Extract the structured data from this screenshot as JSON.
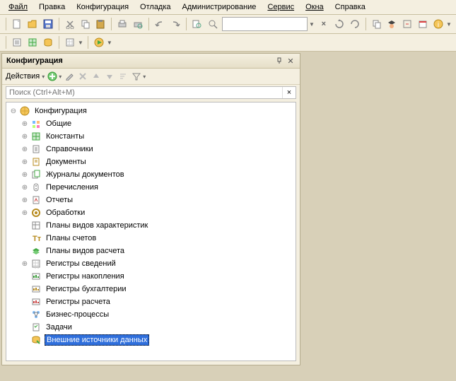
{
  "menu": {
    "file": "Файл",
    "edit": "Правка",
    "config": "Конфигурация",
    "debug": "Отладка",
    "admin": "Администрирование",
    "service": "Сервис",
    "windows": "Окна",
    "help": "Справка"
  },
  "search": {
    "placeholder": "",
    "clear": "×"
  },
  "panel": {
    "title": "Конфигурация",
    "actions_label": "Действия",
    "search_placeholder": "Поиск (Ctrl+Alt+M)",
    "search_clear": "×"
  },
  "tree": {
    "root": "Конфигурация",
    "items": [
      {
        "label": "Общие",
        "exp": "⊕"
      },
      {
        "label": "Константы",
        "exp": "⊕"
      },
      {
        "label": "Справочники",
        "exp": "⊕"
      },
      {
        "label": "Документы",
        "exp": "⊕"
      },
      {
        "label": "Журналы документов",
        "exp": "⊕"
      },
      {
        "label": "Перечисления",
        "exp": "⊕"
      },
      {
        "label": "Отчеты",
        "exp": "⊕"
      },
      {
        "label": "Обработки",
        "exp": "⊕"
      },
      {
        "label": "Планы видов характеристик",
        "exp": ""
      },
      {
        "label": "Планы счетов",
        "exp": ""
      },
      {
        "label": "Планы видов расчета",
        "exp": ""
      },
      {
        "label": "Регистры сведений",
        "exp": "⊕"
      },
      {
        "label": "Регистры накопления",
        "exp": ""
      },
      {
        "label": "Регистры бухгалтерии",
        "exp": ""
      },
      {
        "label": "Регистры расчета",
        "exp": ""
      },
      {
        "label": "Бизнес-процессы",
        "exp": ""
      },
      {
        "label": "Задачи",
        "exp": ""
      },
      {
        "label": "Внешние источники данных",
        "exp": "",
        "selected": true
      }
    ]
  }
}
